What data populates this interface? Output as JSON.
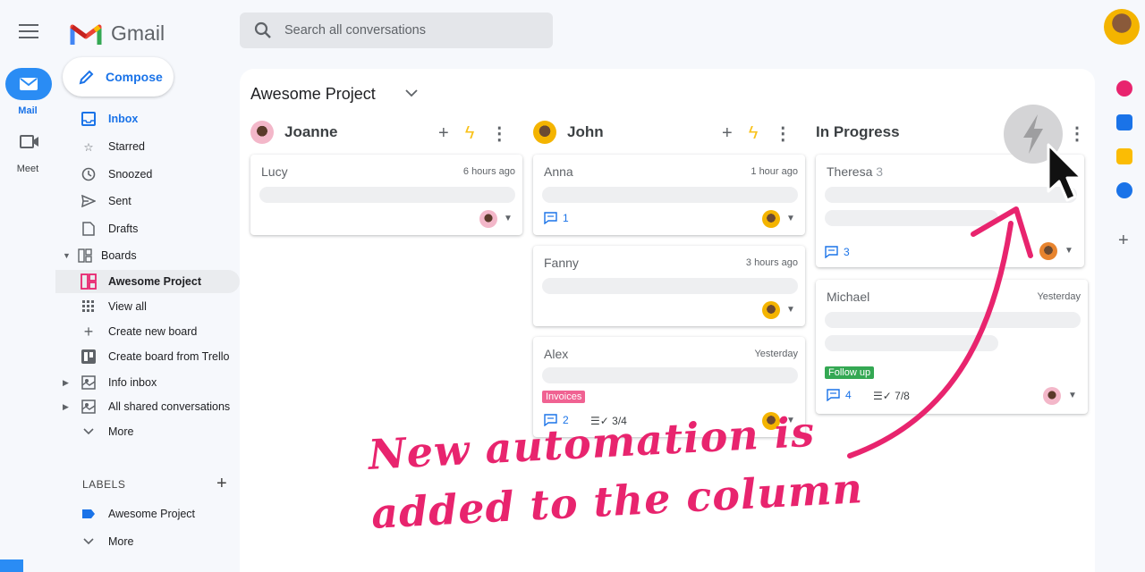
{
  "app": {
    "name": "Gmail"
  },
  "rail": {
    "mail_label": "Mail",
    "meet_label": "Meet"
  },
  "search": {
    "placeholder": "Search all conversations"
  },
  "compose": {
    "label": "Compose"
  },
  "nav": {
    "items": [
      {
        "label": "Inbox",
        "icon": "inbox-icon"
      },
      {
        "label": "Starred",
        "icon": "star-icon"
      },
      {
        "label": "Snoozed",
        "icon": "clock-icon"
      },
      {
        "label": "Sent",
        "icon": "send-icon"
      },
      {
        "label": "Drafts",
        "icon": "draft-icon"
      },
      {
        "label": "Boards",
        "icon": "boards-icon"
      },
      {
        "label": "Awesome Project",
        "icon": "board-icon"
      },
      {
        "label": "View all",
        "icon": "grid-icon"
      },
      {
        "label": "Create new board",
        "icon": "plus-icon"
      },
      {
        "label": "Create board from Trello",
        "icon": "trello-icon"
      },
      {
        "label": "Info inbox",
        "icon": "shared-inbox-icon"
      },
      {
        "label": "All shared conversations",
        "icon": "shared-inbox-icon"
      },
      {
        "label": "More",
        "icon": "chevron-down-icon"
      }
    ],
    "labels_heading": "LABELS",
    "label_items": [
      {
        "label": "Awesome Project",
        "icon": "label-icon"
      },
      {
        "label": "More",
        "icon": "chevron-down-icon"
      }
    ]
  },
  "board": {
    "title": "Awesome Project",
    "columns": [
      {
        "name": "Joanne",
        "cards": [
          {
            "name": "Lucy",
            "time": "6 hours ago"
          }
        ]
      },
      {
        "name": "John",
        "cards": [
          {
            "name": "Anna",
            "time": "1 hour ago",
            "comments": "1"
          },
          {
            "name": "Fanny",
            "time": "3 hours ago"
          },
          {
            "name": "Alex",
            "time": "Yesterday",
            "tag": "Invoices",
            "comments": "2",
            "tasks": "3/4"
          }
        ]
      },
      {
        "name": "In Progress",
        "cards": [
          {
            "name": "Theresa",
            "count": "3",
            "comments": "3"
          },
          {
            "name": "Michael",
            "time": "Yesterday",
            "tag": "Follow up",
            "comments": "4",
            "tasks": "7/8"
          }
        ]
      }
    ]
  },
  "annotation": {
    "line1": "New automation is",
    "line2": "added to the column"
  },
  "colors": {
    "accent": "#1a73e8",
    "mail_pill": "#2a8cf4",
    "automation_bolt": "#f9c21b",
    "annotation": "#e8246e",
    "tag_invoices": "#f06292",
    "tag_follow_up": "#34a853"
  }
}
